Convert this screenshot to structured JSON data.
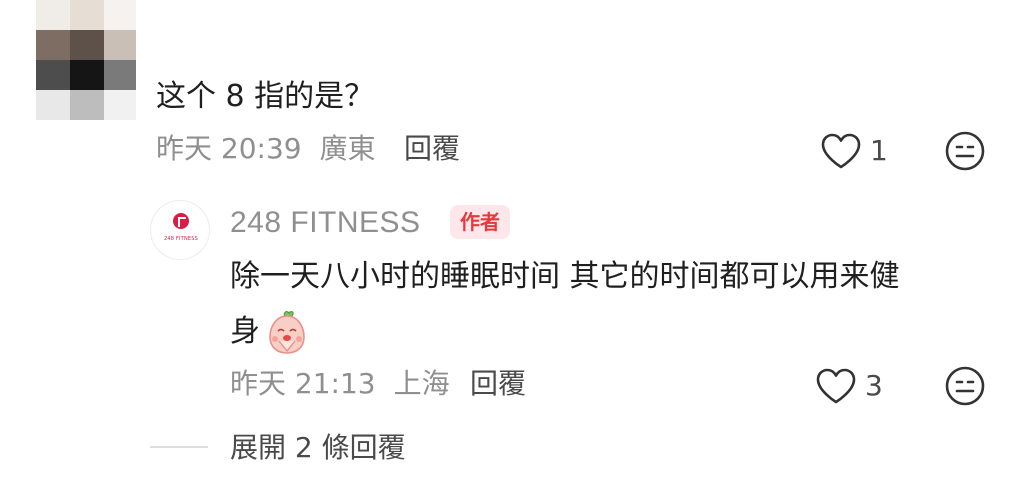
{
  "comment": {
    "text": "这个 8 指的是？",
    "time": "昨天 20:39",
    "location": "廣東",
    "reply_label": "回覆",
    "like_count": "1"
  },
  "reply": {
    "author": "248 FITNESS",
    "author_badge": "作者",
    "logo_text": "248 FITNESS",
    "text_line1": "除一天八小时的睡眠时间 其它的时间都可以用来健",
    "text_line2": "身",
    "time": "昨天 21:13",
    "location": "上海",
    "reply_label": "回覆",
    "like_count": "3"
  },
  "expand": {
    "label": "展開 2 條回覆"
  },
  "icons": {
    "like": "heart-outline-icon",
    "emoji": "emoji-face-icon",
    "sticker": "praying-bun-sticker"
  },
  "colors": {
    "badge_text": "#e8383d",
    "badge_bg": "#fde7ea",
    "brand": "#d81e45",
    "meta": "#8f8f8f"
  }
}
